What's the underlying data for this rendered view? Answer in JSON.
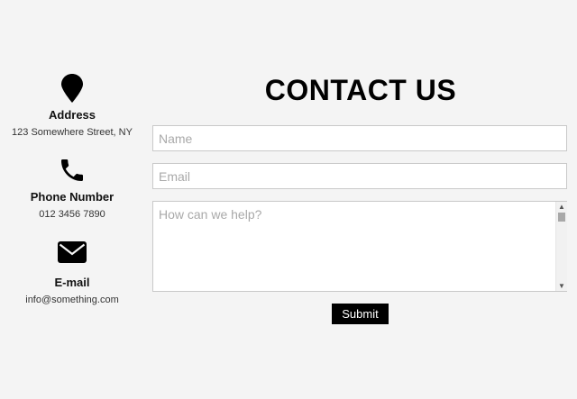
{
  "contact_info": {
    "address": {
      "icon": "map-pin-icon",
      "title": "Address",
      "value": "123 Somewhere Street, NY"
    },
    "phone": {
      "icon": "phone-icon",
      "title": "Phone Number",
      "value": "012 3456 7890"
    },
    "email": {
      "icon": "envelope-icon",
      "title": "E-mail",
      "value": "info@something.com"
    }
  },
  "form": {
    "title": "CONTACT US",
    "name_placeholder": "Name",
    "email_placeholder": "Email",
    "message_placeholder": "How can we help?",
    "submit_label": "Submit"
  },
  "colors": {
    "background": "#f4f4f4",
    "text": "#000000",
    "button_bg": "#000000",
    "button_text": "#ffffff",
    "field_border": "#c9c9c9"
  }
}
